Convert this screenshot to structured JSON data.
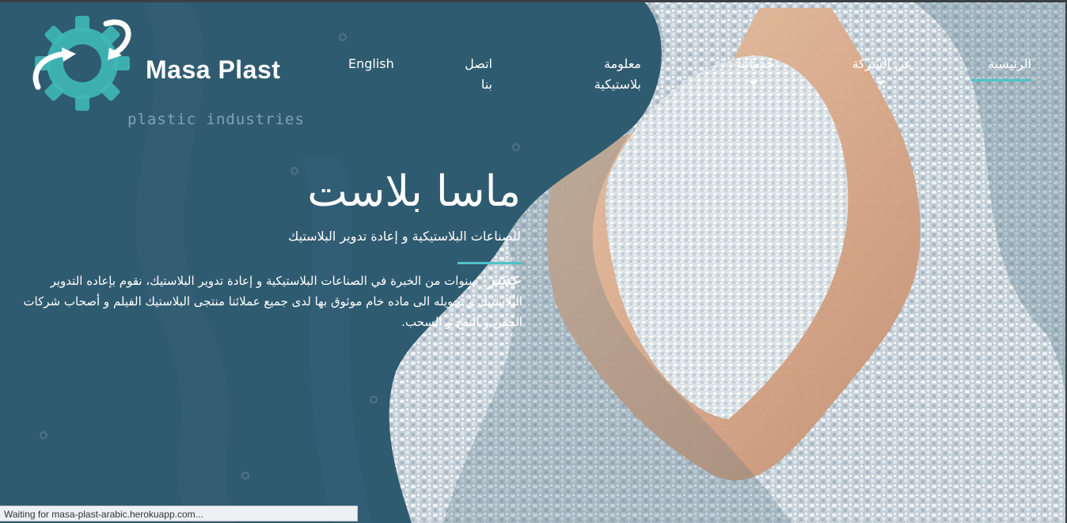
{
  "logo": {
    "name": "Masa Plast",
    "tagline": "plastic industries"
  },
  "nav": {
    "home": "الرئيسية",
    "about": "عن الشركة",
    "services": "خدماتنا",
    "info_line1": "معلومة",
    "info_line2": "بلاستيكية",
    "contact_line1": "اتصل",
    "contact_line2": "بنا",
    "language": "English"
  },
  "hero": {
    "title": "ماسا بلاست",
    "subtitle": "للصناعات البلاستيكية و إعادة تدوير البلاستيك",
    "body_lead": "عشر",
    "body_text": "سنوات من الخبرة في الصناعات البلاستيكية و إعادة تدوير البلاستيك، نقوم بإعاده التدوير البلاستيك و تحويله الى ماده خام موثوق بها لدى جميع عملائنا منتجى البلاستيك الفيلم و أصحاب شركات الحقن و النفخ و السحب."
  },
  "status_bar": {
    "text": "Waiting for masa-plast-arabic.herokuapp.com..."
  },
  "colors": {
    "panel": "#2f5b70",
    "accent": "#4fc3c8",
    "logo_gear": "#3fb8b6"
  },
  "icons": {
    "logo": "gear-with-arrows-icon",
    "dropdown": "caret-down-icon"
  }
}
